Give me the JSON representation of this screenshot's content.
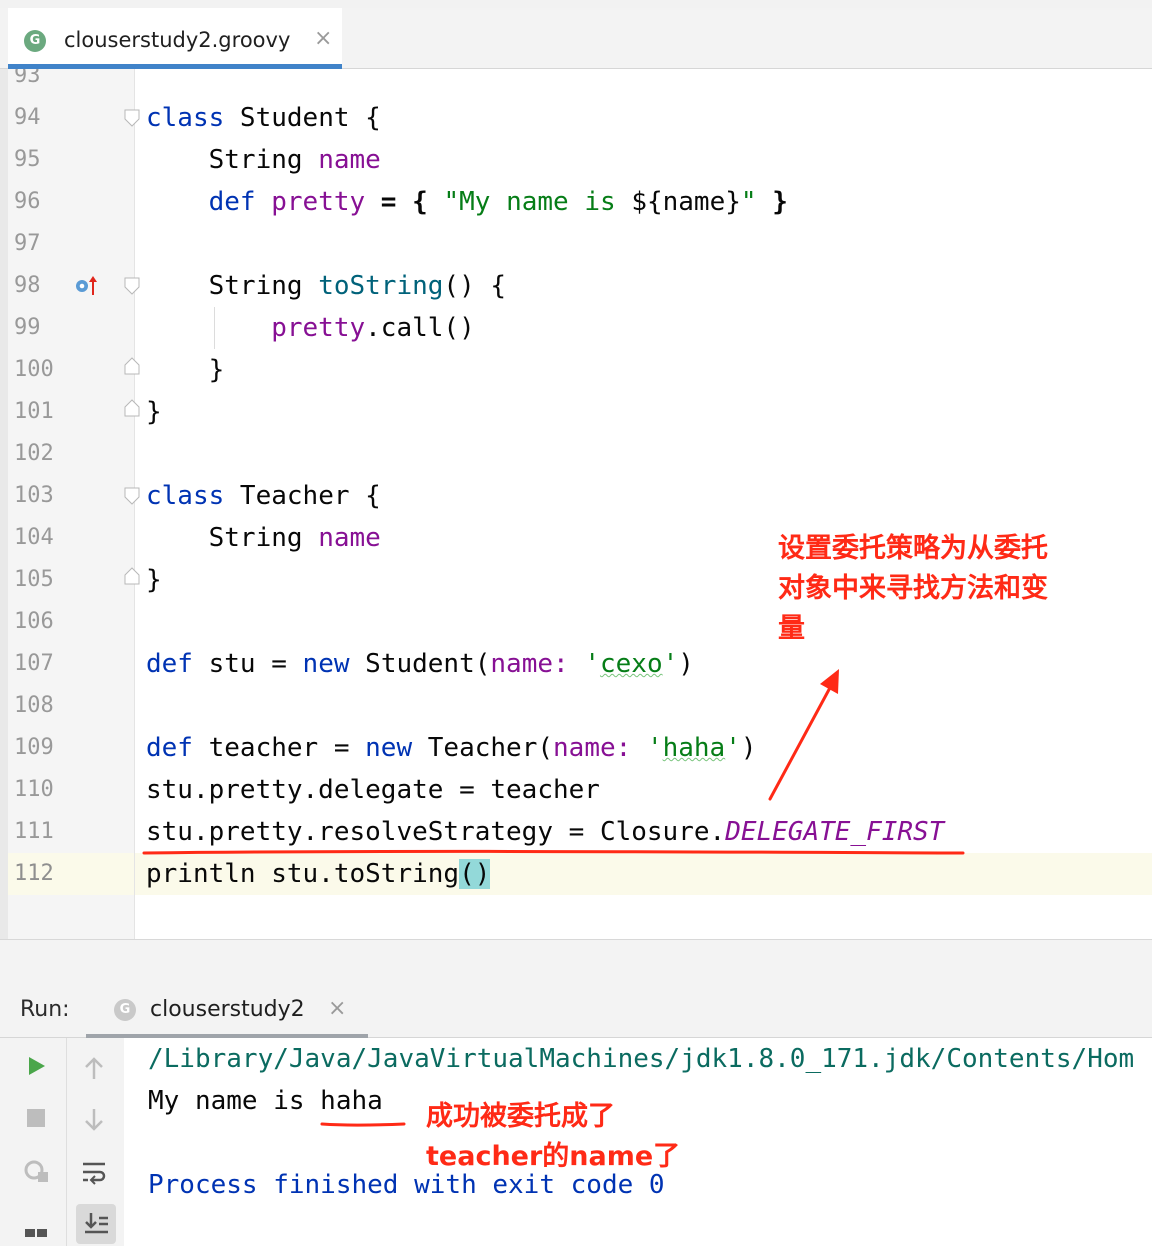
{
  "editor_tab": {
    "file_name": "clouserstudy2.groovy",
    "icon": "groovy-file-icon",
    "close": "×"
  },
  "gutter": {
    "line_numbers": [
      "93",
      "94",
      "95",
      "96",
      "97",
      "98",
      "99",
      "100",
      "101",
      "102",
      "103",
      "104",
      "105",
      "106",
      "107",
      "108",
      "109",
      "110",
      "111",
      "112"
    ]
  },
  "code": {
    "l94": {
      "kw": "class",
      "name": " Student {"
    },
    "l95": {
      "type": "    String ",
      "field": "name"
    },
    "l96": {
      "kw": "    def ",
      "field": "pretty",
      "op": " = { ",
      "str1": "\"My ",
      "str2": "name",
      "str3": " is ",
      "interp": "${name}",
      "str4": "\"",
      "close": " }"
    },
    "l98": {
      "type": "    String ",
      "method": "toString",
      "rest": "() {"
    },
    "l99": {
      "field": "        pretty",
      "rest": ".call()"
    },
    "l100": "    }",
    "l101": "}",
    "l103": {
      "kw": "class",
      "name": " Teacher {"
    },
    "l104": {
      "type": "    String ",
      "field": "name"
    },
    "l105": "}",
    "l107": {
      "kw1": "def",
      "mid": " stu = ",
      "kw2": "new",
      "cls": " Student(",
      "param": "name: ",
      "q1": "'",
      "val": "cexo",
      "q2": "'",
      "end": ")"
    },
    "l109": {
      "kw1": "def",
      "mid": " teacher = ",
      "kw2": "new",
      "cls": " Teacher(",
      "param": "name: ",
      "q1": "'",
      "val": "haha",
      "q2": "'",
      "end": ")"
    },
    "l110": "stu.pretty.delegate = teacher",
    "l111": {
      "pre": "stu.pretty.resolveStrategy = Closure.",
      "const": "DELEGATE_FIRST"
    },
    "l112": {
      "pre": "println stu.toString",
      "paren": "()"
    }
  },
  "run_panel": {
    "label": "Run:",
    "tab_name": "clouserstudy2",
    "tab_icon": "groovy-file-icon",
    "close": "×",
    "toolbar": [
      "run-icon",
      "stop-icon",
      "debug-settings-icon",
      "scroll-up-icon",
      "scroll-down-icon",
      "soft-wrap-icon",
      "scroll-to-end-icon",
      "layout-icon"
    ],
    "console": {
      "path": "/Library/Java/JavaVirtualMachines/jdk1.8.0_171.jdk/Contents/Hom",
      "output": "My name is haha",
      "process": "Process finished with exit code 0"
    }
  },
  "annotations": {
    "top": [
      "设置委托策略为从委托",
      "对象中来寻找方法和变",
      "量"
    ],
    "bottom": [
      "成功被委托成了",
      "teacher的name了"
    ],
    "color": "#ff2a16"
  },
  "colors": {
    "keyword": "#0033b3",
    "field": "#871094",
    "string": "#067d17",
    "method": "#00627a",
    "console_path": "#0b6b60",
    "tab_accent": "#4083c9"
  }
}
